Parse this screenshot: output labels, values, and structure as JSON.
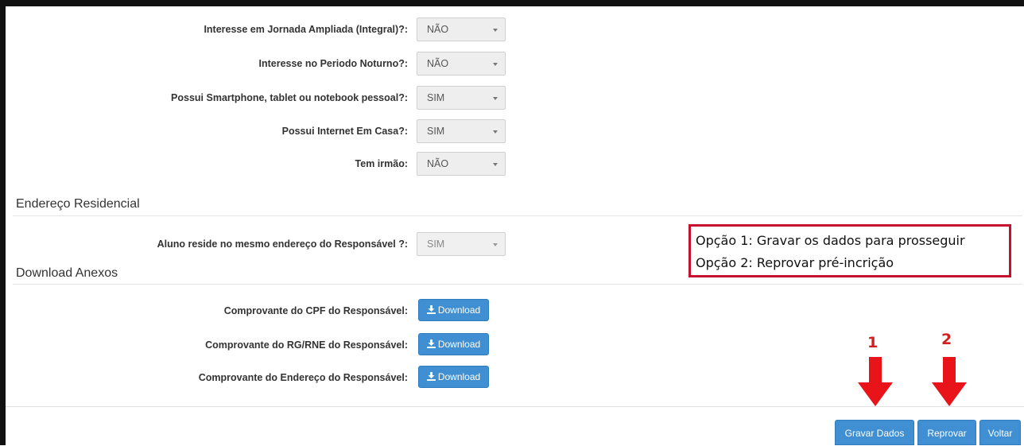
{
  "questions": [
    {
      "label": "Interesse em Jornada Ampliada (Integral)?:",
      "value": "NÃO"
    },
    {
      "label": "Interesse no Periodo Noturno?:",
      "value": "NÃO"
    },
    {
      "label": "Possui Smartphone, tablet ou notebook pessoal?:",
      "value": "SIM"
    },
    {
      "label": "Possui Internet Em Casa?:",
      "value": "SIM"
    },
    {
      "label": "Tem irmão:",
      "value": "NÃO"
    }
  ],
  "endereco": {
    "title": "Endereço Residencial",
    "question": {
      "label": "Aluno reside no mesmo endereço do Responsável ?:",
      "value": "SIM"
    }
  },
  "anexos": {
    "title": "Download Anexos",
    "items": [
      {
        "label": "Comprovante do CPF do Responsável:",
        "button": "Download"
      },
      {
        "label": "Comprovante do RG/RNE do Responsável:",
        "button": "Download"
      },
      {
        "label": "Comprovante do Endereço do Responsável:",
        "button": "Download"
      }
    ]
  },
  "annotation": {
    "lines": [
      "Opção 1: Gravar os dados para prosseguir",
      "Opção 2: Reprovar pré-incrição"
    ],
    "markers": [
      "1",
      "2"
    ],
    "color": "#c8102e"
  },
  "actions": {
    "save": "Gravar Dados",
    "reject": "Reprovar",
    "back": "Voltar"
  },
  "colors": {
    "primary": "#3f8fd2",
    "annotation_red": "#d01f1f"
  }
}
